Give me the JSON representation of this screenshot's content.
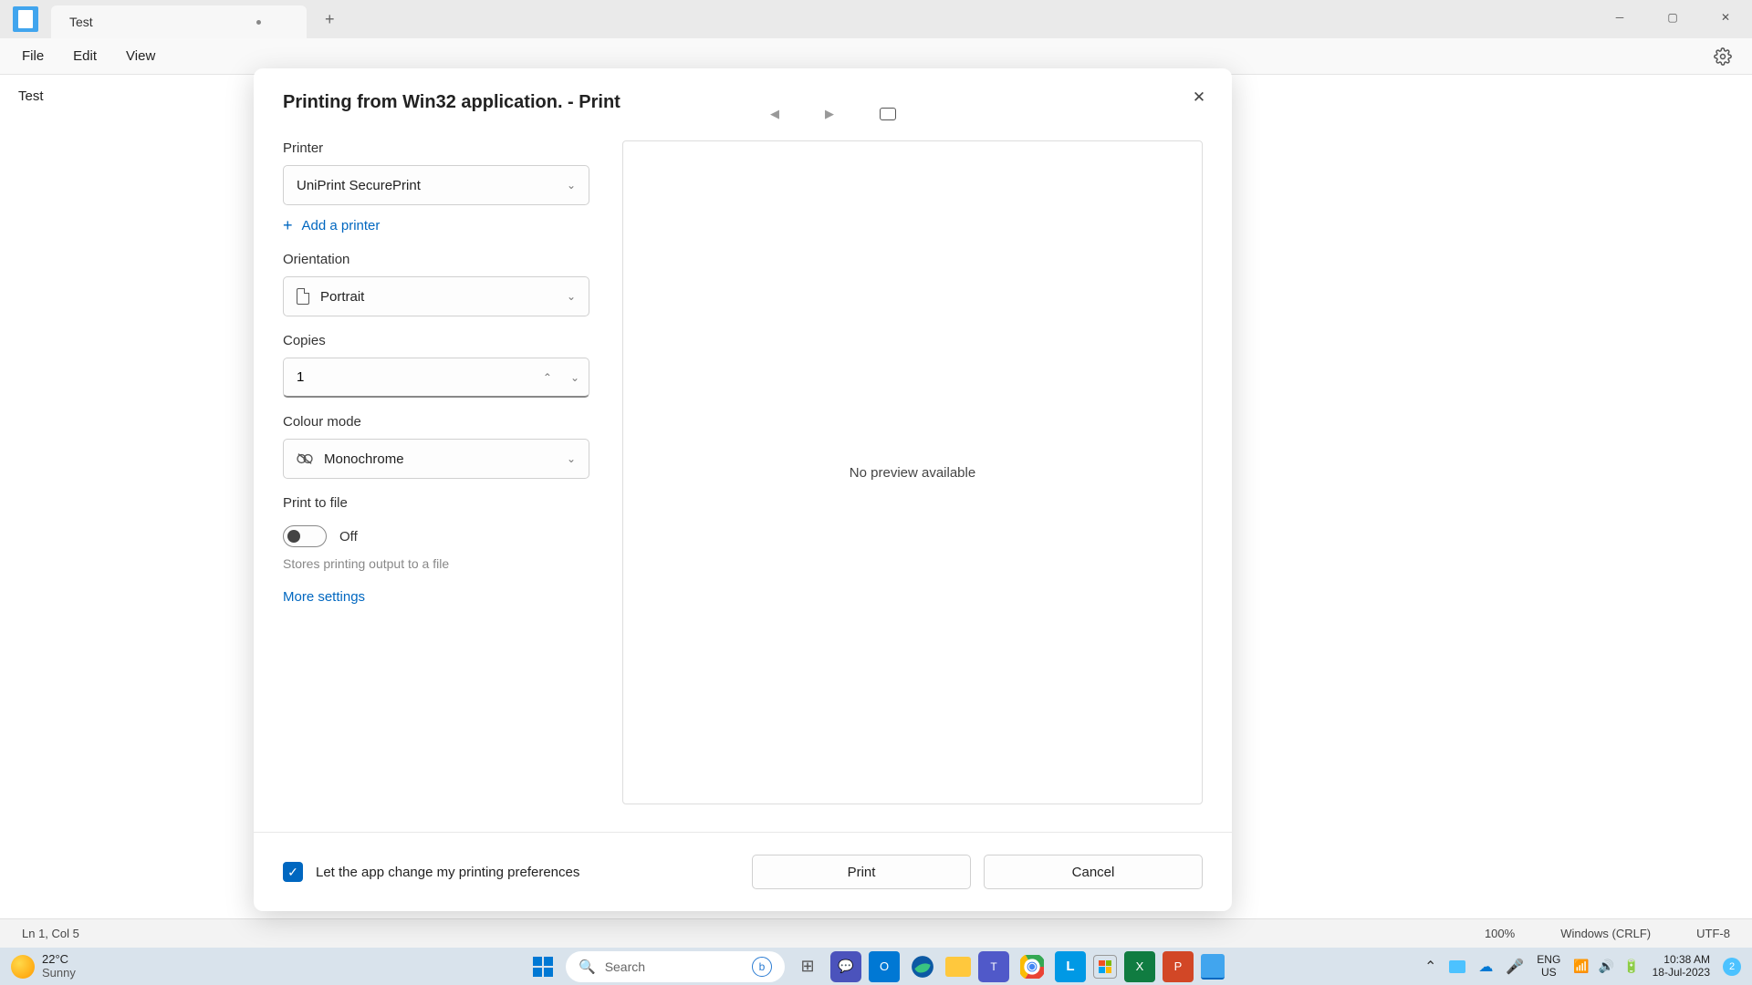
{
  "titlebar": {
    "tab_label": "Test"
  },
  "menubar": {
    "file": "File",
    "edit": "Edit",
    "view": "View"
  },
  "editor": {
    "content": "Test"
  },
  "statusbar": {
    "position": "Ln 1, Col 5",
    "zoom": "100%",
    "line_ending": "Windows (CRLF)",
    "encoding": "UTF-8"
  },
  "dialog": {
    "title": "Printing from Win32 application. - Print",
    "printer_label": "Printer",
    "printer_value": "UniPrint SecurePrint",
    "add_printer": "Add a printer",
    "orientation_label": "Orientation",
    "orientation_value": "Portrait",
    "copies_label": "Copies",
    "copies_value": "1",
    "colour_label": "Colour mode",
    "colour_value": "Monochrome",
    "print_to_file_label": "Print to file",
    "toggle_state": "Off",
    "helper": "Stores printing output to a file",
    "more_settings": "More settings",
    "preview_text": "No preview available",
    "checkbox_label": "Let the app change my printing preferences",
    "print_btn": "Print",
    "cancel_btn": "Cancel"
  },
  "taskbar": {
    "temp": "22°C",
    "condition": "Sunny",
    "search_placeholder": "Search",
    "lang1": "ENG",
    "lang2": "US",
    "time": "10:38 AM",
    "date": "18-Jul-2023",
    "notif_count": "2"
  }
}
